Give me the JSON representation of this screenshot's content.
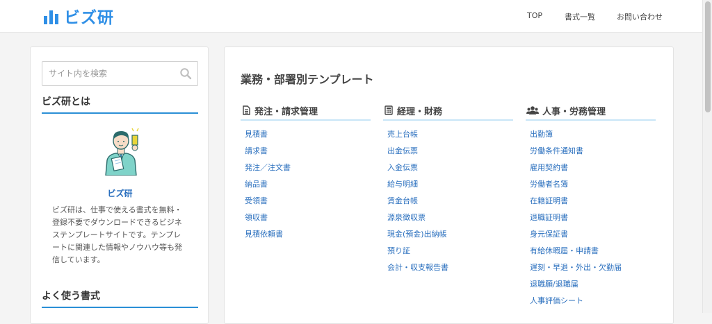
{
  "header": {
    "logo_text": "ビズ研",
    "nav": [
      {
        "label": "TOP"
      },
      {
        "label": "書式一覧"
      },
      {
        "label": "お問い合わせ"
      }
    ]
  },
  "sidebar": {
    "search": {
      "placeholder": "サイト内を検索",
      "value": ""
    },
    "about": {
      "heading": "ビズ研とは",
      "name": "ビズ研",
      "description": "ビズ研は、仕事で使える書式を無料・登録不要でダウンロードできるビジネステンプレートサイトです。テンプレートに関連した情報やノウハウ等も発信しています。"
    },
    "frequent_heading": "よく使う書式"
  },
  "main": {
    "title": "業務・部署別テンプレート",
    "columns": [
      {
        "icon": "document-icon",
        "title": "発注・請求管理",
        "items": [
          "見積書",
          "請求書",
          "発注／注文書",
          "納品書",
          "受領書",
          "領収書",
          "見積依頼書"
        ]
      },
      {
        "icon": "calculator-icon",
        "title": "経理・財務",
        "items": [
          "売上台帳",
          "出金伝票",
          "入金伝票",
          "給与明細",
          "賃金台帳",
          "源泉徴収票",
          "現金(預金)出納帳",
          "預り証",
          "会計・収支報告書"
        ]
      },
      {
        "icon": "users-icon",
        "title": "人事・労務管理",
        "items": [
          "出勤簿",
          "労働条件通知書",
          "雇用契約書",
          "労働者名簿",
          "在籍証明書",
          "退職証明書",
          "身元保証書",
          "有給休暇届・申請書",
          "遅刻・早退・外出・欠勤届",
          "退職願/退職届",
          "人事評価シート"
        ]
      }
    ]
  },
  "colors": {
    "brand": "#2f8fe6",
    "link": "#2a6fbe",
    "accent_rule": "#2a8fd6",
    "column_rule": "#c9e6f7"
  }
}
